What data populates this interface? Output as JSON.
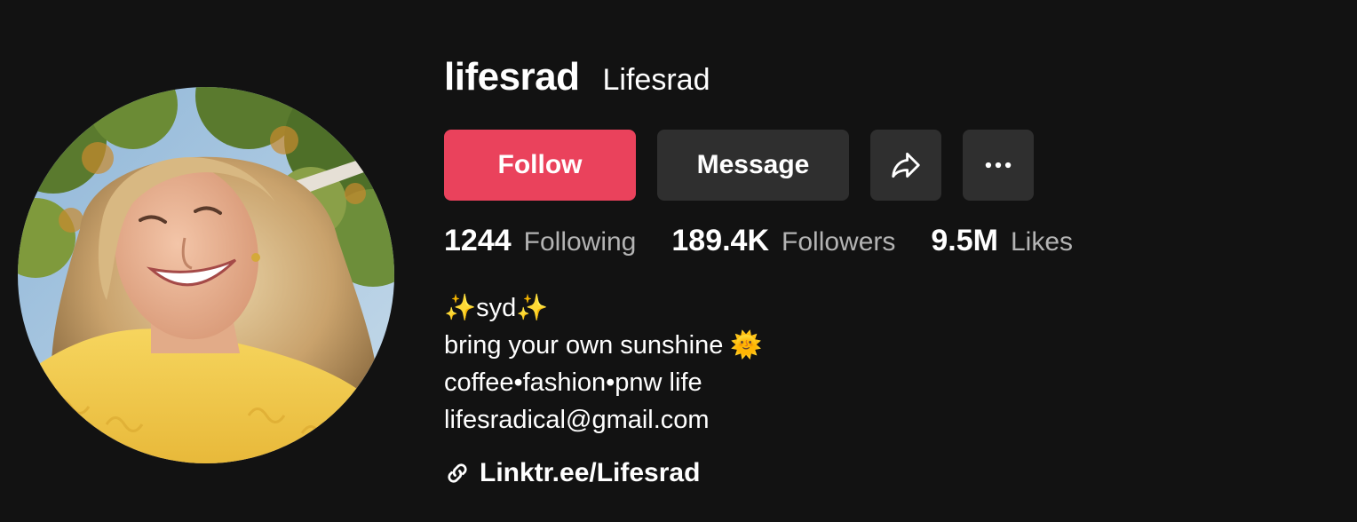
{
  "profile": {
    "username": "lifesrad",
    "nickname": "Lifesrad",
    "avatar_icon": "profile-photo"
  },
  "actions": {
    "follow_label": "Follow",
    "message_label": "Message",
    "share_icon": "share-icon",
    "more_icon": "more-icon"
  },
  "stats": [
    {
      "value": "1244",
      "label": "Following"
    },
    {
      "value": "189.4K",
      "label": "Followers"
    },
    {
      "value": "9.5M",
      "label": "Likes"
    }
  ],
  "bio": {
    "lines": [
      "✨syd✨",
      "bring your own sunshine 🌞",
      "coffee•fashion•pnw life",
      "lifesradical@gmail.com"
    ]
  },
  "link": {
    "text": "Linktr.ee/Lifesrad",
    "icon": "link-icon"
  },
  "colors": {
    "background": "#121212",
    "follow": "#ea425c",
    "secondary_button": "#2f2f2f",
    "muted_text": "#b3b3b3"
  }
}
